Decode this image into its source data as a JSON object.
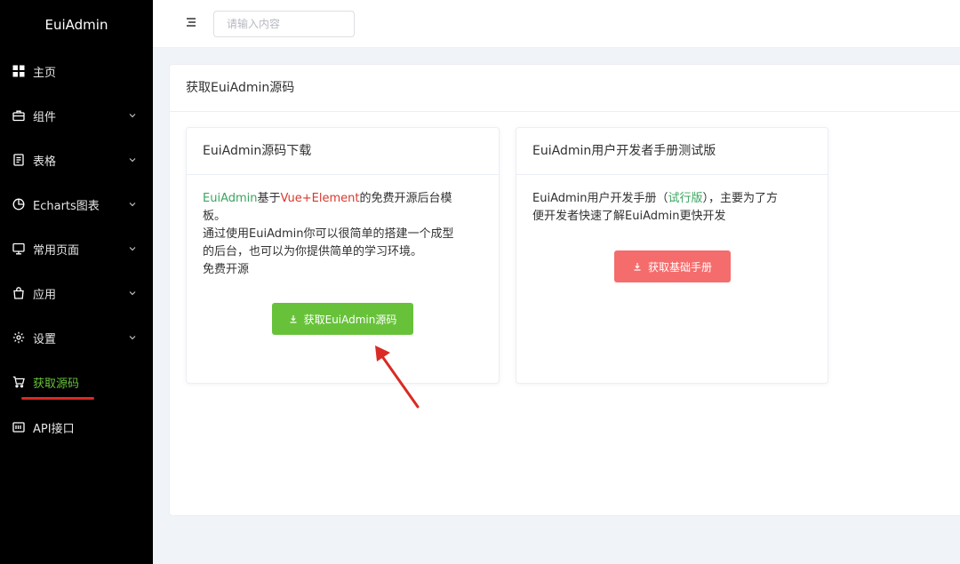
{
  "app": {
    "logo": "EuiAdmin"
  },
  "sidebar": {
    "items": [
      {
        "label": "主页",
        "icon": "grid-icon",
        "has_children": false
      },
      {
        "label": "组件",
        "icon": "briefcase-icon",
        "has_children": true
      },
      {
        "label": "表格",
        "icon": "document-icon",
        "has_children": true
      },
      {
        "label": "Echarts图表",
        "icon": "pie-chart-icon",
        "has_children": true
      },
      {
        "label": "常用页面",
        "icon": "monitor-icon",
        "has_children": true
      },
      {
        "label": "应用",
        "icon": "shopping-bag-icon",
        "has_children": true
      },
      {
        "label": "设置",
        "icon": "gear-icon",
        "has_children": true
      },
      {
        "label": "获取源码",
        "icon": "cart-icon",
        "has_children": false,
        "active": true
      },
      {
        "label": "API接口",
        "icon": "api-icon",
        "has_children": false
      }
    ]
  },
  "header": {
    "menu_icon": "hamburger-icon",
    "search_placeholder": "请输入内容"
  },
  "main": {
    "title": "获取EuiAdmin源码",
    "cards": [
      {
        "title": "EuiAdmin源码下载",
        "desc_part1": "EuiAdmin",
        "desc_part2": "基于",
        "desc_part3": "Vue+Element",
        "desc_part4": "的免费开源后台模",
        "desc_line2": "板。",
        "desc_line3": "通过使用EuiAdmin你可以很简单的搭建一个成型",
        "desc_line4": "的后台，也可以为你提供简单的学习环境。",
        "desc_line5": "免费开源",
        "button_label": "获取EuiAdmin源码"
      },
      {
        "title": "EuiAdmin用户开发者手册测试版",
        "desc_part1": "EuiAdmin用户开发手册（",
        "desc_part2": "试行版",
        "desc_part3": "），主要为了方",
        "desc_line2": "便开发者快速了解EuiAdmin更快开发",
        "button_label": "获取基础手册"
      }
    ]
  },
  "colors": {
    "sidebar_bg": "#000000",
    "active": "#67c23a",
    "button_green": "#67c23a",
    "button_red": "#f56c6c",
    "highlight_green": "#3aa55f",
    "highlight_red": "#d9382d",
    "annotation": "#d92a24"
  }
}
